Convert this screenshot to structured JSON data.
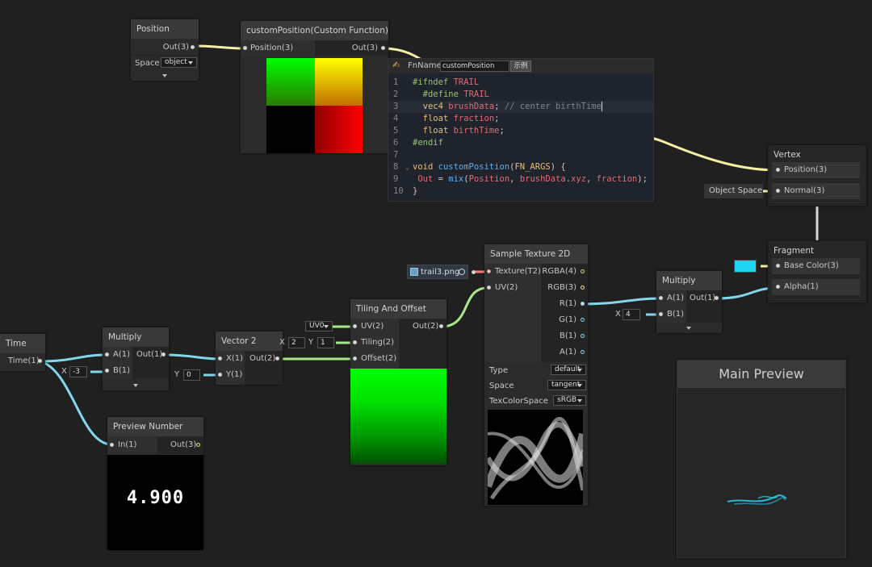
{
  "colors": {
    "canvas": "#202020",
    "wire_vec3": "#f3f0a6",
    "wire_float": "#84d7ea",
    "wire_vec2": "#a8e88a",
    "wire_texture": "#f08080",
    "base_color_swatch": "#1dd5f0"
  },
  "position_node": {
    "title": "Position",
    "out": "Out(3)",
    "space_label": "Space",
    "space_value": "object"
  },
  "custom_fn_node": {
    "title": "customPosition(Custom Function)",
    "in": "Position(3)",
    "out": "Out(3)"
  },
  "code_editor": {
    "fn_icon": "pen-icon",
    "fn_label": "FnName",
    "fn_value": "customPosition",
    "example_button": "示例",
    "lines": [
      {
        "n": "1",
        "text": "#ifndef TRAIL"
      },
      {
        "n": "2",
        "text": "  #define TRAIL"
      },
      {
        "n": "3",
        "text": "  vec4 brushData; // center birthTime"
      },
      {
        "n": "4",
        "text": "  float fraction;"
      },
      {
        "n": "5",
        "text": "  float birthTime;"
      },
      {
        "n": "6",
        "text": "#endif"
      },
      {
        "n": "7",
        "text": ""
      },
      {
        "n": "8",
        "text": "void customPosition(FN_ARGS) {"
      },
      {
        "n": "9",
        "text": " Out = mix(Position, brushData.xyz, fraction);"
      },
      {
        "n": "10",
        "text": "}"
      }
    ]
  },
  "vertex_node": {
    "title": "Vertex",
    "position": "Position(3)",
    "normal": "Normal(3)",
    "normal_source": "Object Space"
  },
  "fragment_node": {
    "title": "Fragment",
    "base_color": "Base Color(3)",
    "alpha": "Alpha(1)"
  },
  "time_node": {
    "title": "Time",
    "out": "Time(1)"
  },
  "multiply1_node": {
    "title": "Multiply",
    "a": "A(1)",
    "b": "B(1)",
    "out": "Out(1)",
    "x_label": "X",
    "x_value": "-3"
  },
  "vector2_node": {
    "title": "Vector 2",
    "x": "X(1)",
    "y": "Y(1)",
    "out": "Out(2)",
    "x_label": "X",
    "y_label": "Y",
    "y_value": "0"
  },
  "tiling_node": {
    "title": "Tiling And Offset",
    "uv": "UV(2)",
    "tiling": "Tiling(2)",
    "offset": "Offset(2)",
    "out": "Out(2)",
    "uv_select": "UV0",
    "tx_label": "X",
    "tx_value": "2",
    "ty_label": "Y",
    "ty_value": "1"
  },
  "texture_asset": {
    "name": "trail3.png",
    "icon": "texture-icon"
  },
  "sample_node": {
    "title": "Sample Texture 2D",
    "in_texture": "Texture(T2)",
    "in_uv": "UV(2)",
    "outs": [
      "RGBA(4)",
      "RGB(3)",
      "R(1)",
      "G(1)",
      "B(1)",
      "A(1)"
    ],
    "type_label": "Type",
    "type_value": "default",
    "space_label": "Space",
    "space_value": "tangent",
    "colorspace_label": "TexColorSpace",
    "colorspace_value": "sRGB"
  },
  "multiply2_node": {
    "title": "Multiply",
    "a": "A(1)",
    "b": "B(1)",
    "out": "Out(1)",
    "x_label": "X",
    "x_value": "4"
  },
  "preview_number_node": {
    "title": "Preview Number",
    "in": "In(1)",
    "out": "Out(3)",
    "value": "4.900"
  },
  "main_preview": {
    "title": "Main Preview"
  }
}
